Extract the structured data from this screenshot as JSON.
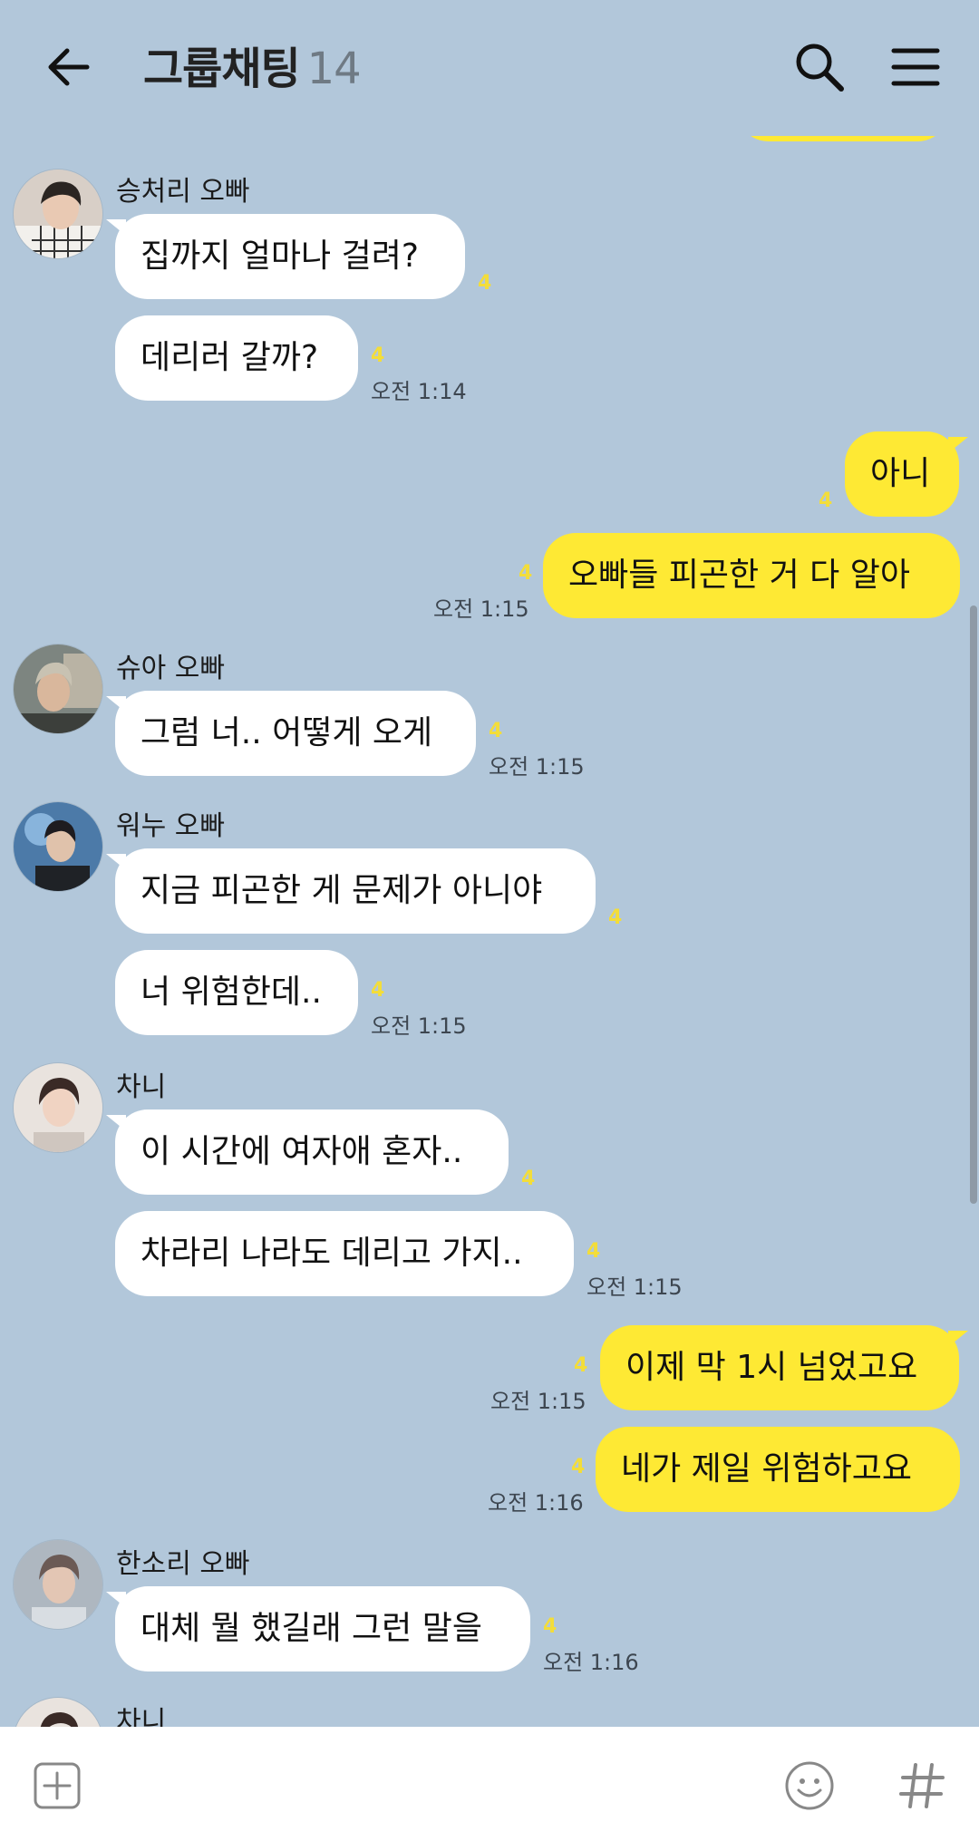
{
  "header": {
    "title": "그룹채팅",
    "member_count": "14"
  },
  "messages": [
    {
      "sender": "승처리 오빠",
      "bubbles": [
        "집까지 얼마나 걸려?",
        "데리러 갈까?"
      ],
      "unread": [
        "4",
        "4"
      ],
      "time": "오전 1:14"
    },
    {
      "sender": "me",
      "bubbles": [
        "아니",
        "오빠들 피곤한 거 다 알아"
      ],
      "unread": [
        "4",
        "4"
      ],
      "time": "오전 1:15"
    },
    {
      "sender": "슈아 오빠",
      "bubbles": [
        "그럼 너.. 어떻게 오게"
      ],
      "unread": [
        "4"
      ],
      "time": "오전 1:15"
    },
    {
      "sender": "워누 오빠",
      "bubbles": [
        "지금 피곤한 게 문제가 아니야",
        "너 위험한데.."
      ],
      "unread": [
        "4",
        "4"
      ],
      "time": "오전 1:15"
    },
    {
      "sender": "차니",
      "bubbles": [
        "이 시간에 여자애 혼자..",
        "차라리 나라도 데리고 가지.."
      ],
      "unread": [
        "4",
        "4"
      ],
      "time": "오전 1:15"
    },
    {
      "sender": "me",
      "bubbles": [
        "이제 막 1시 넘었고요",
        "네가 제일 위험하고요"
      ],
      "unread": [
        "4",
        "4"
      ],
      "times": [
        "오전 1:15",
        "오전 1:16"
      ]
    },
    {
      "sender": "한소리 오빠",
      "bubbles": [
        "대체 뭘 했길래 그런 말을"
      ],
      "unread": [
        "4"
      ],
      "time": "오전 1:16"
    },
    {
      "sender": "차니",
      "bubbles": []
    }
  ],
  "colors": {
    "background": "#b2c7da",
    "my_bubble": "#fee934",
    "their_bubble": "#ffffff",
    "unread": "#f3dd3a"
  },
  "icons": [
    "back-arrow-icon",
    "search-icon",
    "menu-icon",
    "plus-icon",
    "emoji-icon",
    "hash-icon"
  ]
}
